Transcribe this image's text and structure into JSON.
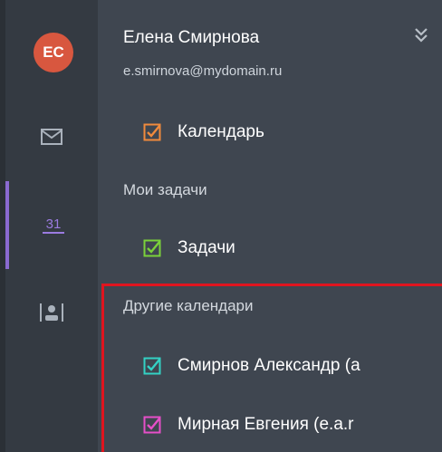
{
  "user": {
    "initials": "ЕС",
    "name": "Елена Смирнова",
    "email": "e.smirnova@mydomain.ru"
  },
  "rail": {
    "calendar_day": "31"
  },
  "calendars": {
    "main": {
      "label": "Календарь",
      "color": "#f08a3c"
    }
  },
  "tasks": {
    "section_label": "Мои задачи",
    "items": [
      {
        "label": "Задачи",
        "color": "#7bd13a"
      }
    ]
  },
  "other_calendars": {
    "section_label": "Другие календари",
    "items": [
      {
        "label": "Смирнов Александр (a",
        "color": "#33d1c4"
      },
      {
        "label": "Мирная Евгения (e.a.r",
        "color": "#e64fc8"
      }
    ]
  },
  "highlight_color": "#e0151f"
}
